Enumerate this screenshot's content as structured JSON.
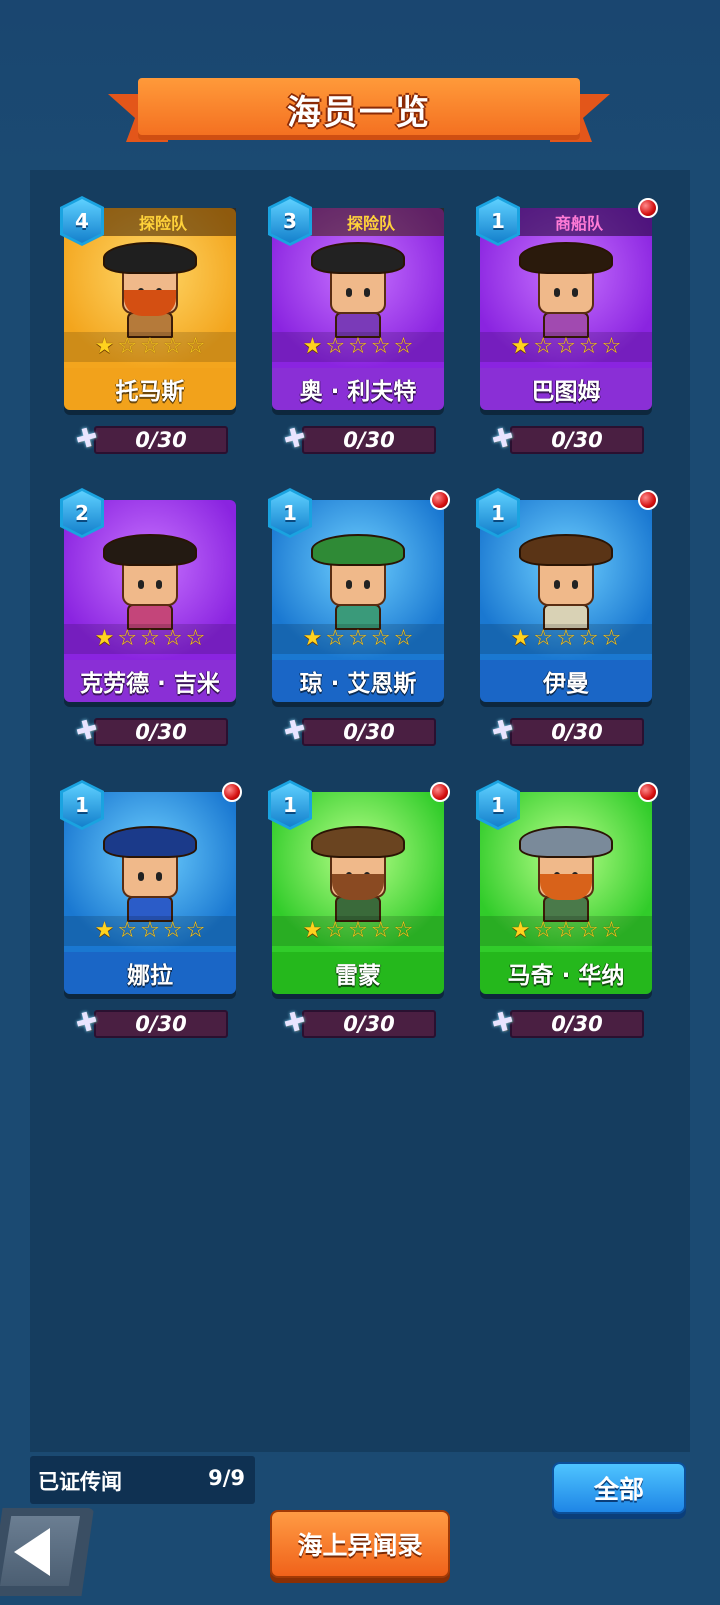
{
  "title": "海员一览",
  "crew": [
    {
      "name": "托马斯",
      "level": "4",
      "team": "探险队",
      "team_type": "explore",
      "rarity": "gold",
      "stars": 1,
      "max_stars": 5,
      "progress": "0/30",
      "alert": false,
      "hat_color": "#1f1f1f",
      "torso_color": "#b57a3a",
      "beard_color": "#d44f12"
    },
    {
      "name": "奥 · 利夫特",
      "level": "3",
      "team": "探险队",
      "team_type": "explore",
      "rarity": "purple",
      "stars": 1,
      "max_stars": 5,
      "progress": "0/30",
      "alert": false,
      "hat_color": "#222222",
      "torso_color": "#7a3ab8",
      "beard_color": ""
    },
    {
      "name": "巴图姆",
      "level": "1",
      "team": "商船队",
      "team_type": "merchant",
      "rarity": "purple",
      "stars": 1,
      "max_stars": 5,
      "progress": "0/30",
      "alert": true,
      "hat_color": "#2a1a0c",
      "torso_color": "#a14ab0",
      "beard_color": ""
    },
    {
      "name": "克劳德 · 吉米",
      "level": "2",
      "team": "",
      "team_type": "",
      "rarity": "purple",
      "stars": 1,
      "max_stars": 5,
      "progress": "0/30",
      "alert": false,
      "hat_color": "#231a12",
      "torso_color": "#c4457a",
      "beard_color": ""
    },
    {
      "name": "琼 · 艾恩斯",
      "level": "1",
      "team": "",
      "team_type": "",
      "rarity": "blue",
      "stars": 1,
      "max_stars": 5,
      "progress": "0/30",
      "alert": true,
      "hat_color": "#2f8a36",
      "torso_color": "#3a9a7a",
      "beard_color": ""
    },
    {
      "name": "伊曼",
      "level": "1",
      "team": "",
      "team_type": "",
      "rarity": "blue",
      "stars": 1,
      "max_stars": 5,
      "progress": "0/30",
      "alert": true,
      "hat_color": "#5a3416",
      "torso_color": "#d9d2b5",
      "beard_color": ""
    },
    {
      "name": "娜拉",
      "level": "1",
      "team": "",
      "team_type": "",
      "rarity": "blue",
      "stars": 1,
      "max_stars": 5,
      "progress": "0/30",
      "alert": true,
      "hat_color": "#1b3a8a",
      "torso_color": "#2b5cc8",
      "beard_color": ""
    },
    {
      "name": "雷蒙",
      "level": "1",
      "team": "",
      "team_type": "",
      "rarity": "green",
      "stars": 1,
      "max_stars": 5,
      "progress": "0/30",
      "alert": true,
      "hat_color": "#6a4420",
      "torso_color": "#3a6a3a",
      "beard_color": "#8a4a22"
    },
    {
      "name": "马奇 · 华纳",
      "level": "1",
      "team": "",
      "team_type": "",
      "rarity": "green",
      "stars": 1,
      "max_stars": 5,
      "progress": "0/30",
      "alert": true,
      "hat_color": "#7a8a9a",
      "torso_color": "#4a7a4a",
      "beard_color": "#d8621a"
    }
  ],
  "footer": {
    "stat_label": "已证传闻",
    "stat_count": "9/9",
    "filter_button": "全部",
    "log_button": "海上异闻录"
  },
  "icons": {
    "back": "back-arrow-icon",
    "fragment": "puzzle-piece-icon",
    "alert": "red-dot-icon"
  }
}
